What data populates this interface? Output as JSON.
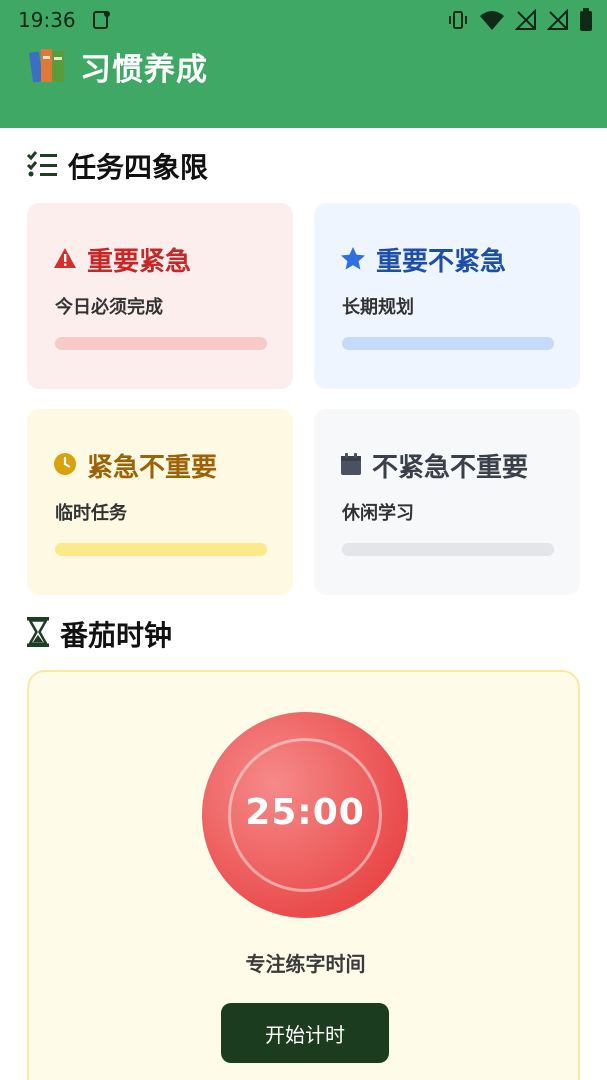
{
  "status_bar": {
    "time": "19:36"
  },
  "app": {
    "title": "习惯养成",
    "icon": "books-icon"
  },
  "quadrant_section": {
    "title": "任务四象限",
    "icon": "checklist-icon",
    "cards": [
      {
        "title": "重要紧急",
        "subtitle": "今日必须完成",
        "icon": "warning-icon",
        "color": "#c62828"
      },
      {
        "title": "重要不紧急",
        "subtitle": "长期规划",
        "icon": "star-icon",
        "color": "#1e4fa8"
      },
      {
        "title": "紧急不重要",
        "subtitle": "临时任务",
        "icon": "clock-icon",
        "color": "#d9a10c"
      },
      {
        "title": "不紧急不重要",
        "subtitle": "休闲学习",
        "icon": "calendar-icon",
        "color": "#3a3f4a"
      }
    ]
  },
  "pomodoro_section": {
    "title": "番茄时钟",
    "icon": "hourglass-icon",
    "timer": "25:00",
    "label": "专注练字时间",
    "start_button": "开始计时"
  }
}
